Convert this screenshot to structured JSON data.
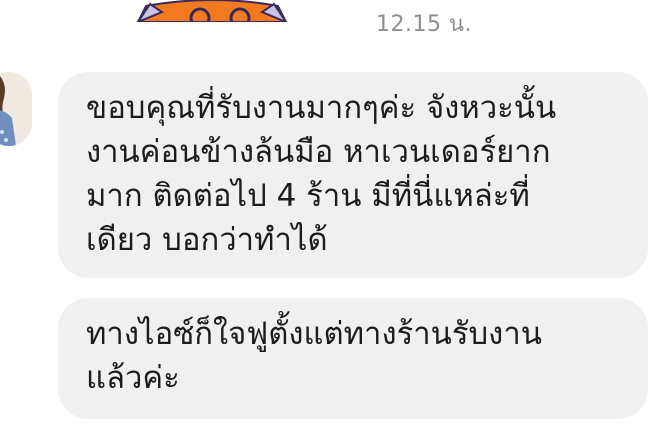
{
  "chat": {
    "timestamp": "12.15 น.",
    "messages": [
      {
        "lines": [
          "ขอบคุณที่รับงานมากๆค่ะ จังหวะนั้น",
          "งานค่อนข้างล้นมือ หาเวนเดอร์ยาก",
          "มาก ติดต่อไป 4 ร้าน มีที่นี่แหล่ะที่",
          "เดียว บอกว่าทำได้"
        ]
      },
      {
        "lines": [
          "ทางไอซ์ก็ใจฟูตั้งแต่ทางร้านรับงาน",
          "แล้วค่ะ"
        ]
      }
    ]
  },
  "colors": {
    "bubble": "#f0f0f0",
    "timestamp": "#8e8e93",
    "text": "#1c1c1e",
    "sticker_orange": "#f47a20"
  },
  "icons": {
    "sticker": "cartoon-sticker-icon",
    "avatar": "contact-avatar"
  }
}
